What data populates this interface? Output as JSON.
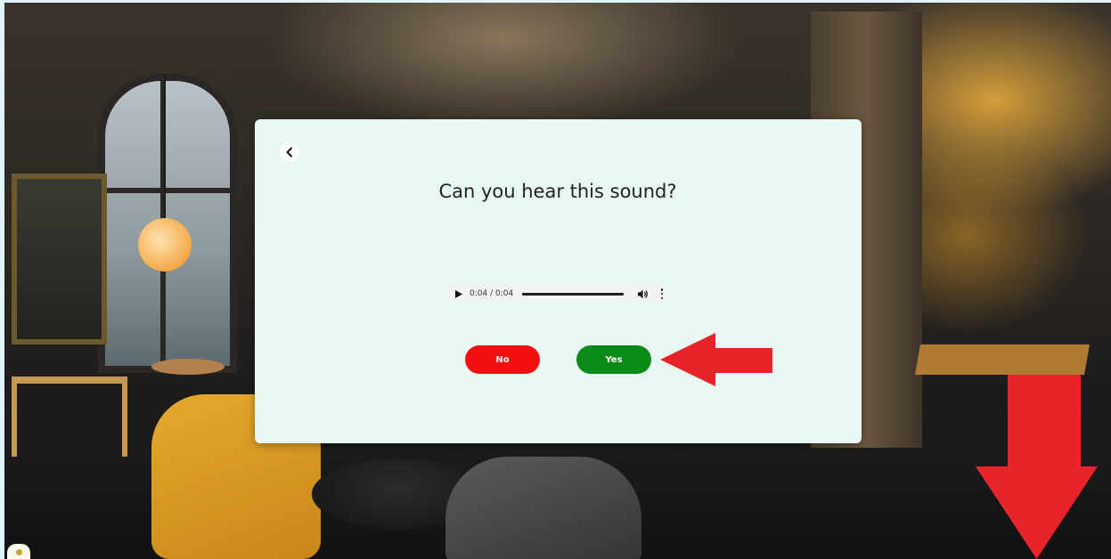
{
  "dialog": {
    "question": "Can you hear this sound?",
    "back_icon": "chevron-left-icon"
  },
  "audio": {
    "time_display": "0:04 / 0:04",
    "progress_fraction": 1.0,
    "play_icon": "play-icon",
    "volume_icon": "volume-icon",
    "menu_icon": "more-vertical-icon"
  },
  "buttons": {
    "no_label": "No",
    "yes_label": "Yes"
  },
  "colors": {
    "no_button": "#f30f0f",
    "yes_button": "#0a8a16",
    "annotation_arrow": "#e8242b",
    "dialog_background": "#e9f7f5"
  },
  "annotations": {
    "arrow_left_icon": "arrow-left-icon",
    "arrow_down_icon": "arrow-down-icon"
  }
}
